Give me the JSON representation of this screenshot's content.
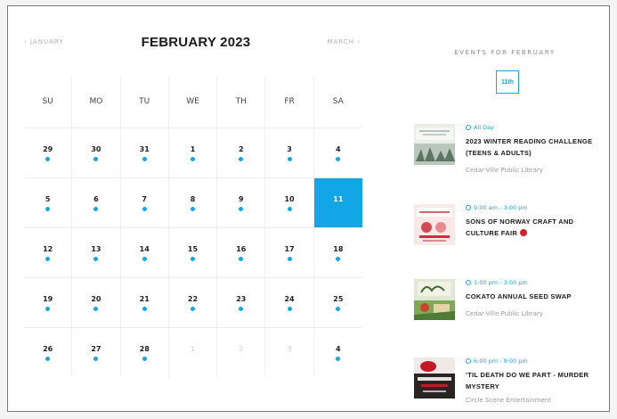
{
  "calendar": {
    "prev_label": "‹ JANUARY",
    "next_label": "MARCH ›",
    "month_title": "FEBRUARY 2023",
    "weekdays": [
      "SU",
      "MO",
      "TU",
      "WE",
      "TH",
      "FR",
      "SA"
    ],
    "weeks": [
      [
        {
          "d": "29",
          "dot": true,
          "muted": false
        },
        {
          "d": "30",
          "dot": true,
          "muted": false
        },
        {
          "d": "31",
          "dot": true,
          "muted": false
        },
        {
          "d": "1",
          "dot": true,
          "muted": false
        },
        {
          "d": "2",
          "dot": true,
          "muted": false
        },
        {
          "d": "3",
          "dot": true,
          "muted": false
        },
        {
          "d": "4",
          "dot": true,
          "muted": false
        }
      ],
      [
        {
          "d": "5",
          "dot": true,
          "muted": false
        },
        {
          "d": "6",
          "dot": true,
          "muted": false
        },
        {
          "d": "7",
          "dot": true,
          "muted": false
        },
        {
          "d": "8",
          "dot": true,
          "muted": false
        },
        {
          "d": "9",
          "dot": true,
          "muted": false
        },
        {
          "d": "10",
          "dot": true,
          "muted": false
        },
        {
          "d": "11",
          "dot": false,
          "muted": false,
          "selected": true
        }
      ],
      [
        {
          "d": "12",
          "dot": true,
          "muted": false
        },
        {
          "d": "13",
          "dot": true,
          "muted": false
        },
        {
          "d": "14",
          "dot": true,
          "muted": false
        },
        {
          "d": "15",
          "dot": true,
          "muted": false
        },
        {
          "d": "16",
          "dot": true,
          "muted": false
        },
        {
          "d": "17",
          "dot": true,
          "muted": false
        },
        {
          "d": "18",
          "dot": true,
          "muted": false
        }
      ],
      [
        {
          "d": "19",
          "dot": true,
          "muted": false
        },
        {
          "d": "20",
          "dot": true,
          "muted": false
        },
        {
          "d": "21",
          "dot": true,
          "muted": false
        },
        {
          "d": "22",
          "dot": true,
          "muted": false
        },
        {
          "d": "23",
          "dot": true,
          "muted": false
        },
        {
          "d": "24",
          "dot": true,
          "muted": false
        },
        {
          "d": "25",
          "dot": true,
          "muted": false
        }
      ],
      [
        {
          "d": "26",
          "dot": true,
          "muted": false
        },
        {
          "d": "27",
          "dot": true,
          "muted": false
        },
        {
          "d": "28",
          "dot": true,
          "muted": false
        },
        {
          "d": "1",
          "dot": false,
          "muted": true
        },
        {
          "d": "2",
          "dot": false,
          "muted": true
        },
        {
          "d": "3",
          "dot": false,
          "muted": true
        },
        {
          "d": "4",
          "dot": true,
          "muted": false
        }
      ]
    ]
  },
  "events_panel": {
    "title": "EVENTS FOR FEBRUARY",
    "day_tag": "11th",
    "events": [
      {
        "time": "All Day",
        "title": "2023 WINTER READING CHALLENGE (TEENS & ADULTS)",
        "venue": "Cedar-Ville Public Library",
        "red_dot": false
      },
      {
        "time": "9:00 am - 3:00 pm",
        "title": "SONS OF NORWAY CRAFT AND CULTURE FAIR",
        "venue": "",
        "red_dot": true
      },
      {
        "time": "1:00 pm - 3:00 pm",
        "title": "COKATO ANNUAL SEED SWAP",
        "venue": "Cedar-Ville Public Library",
        "red_dot": false
      },
      {
        "time": "6:00 pm - 9:00 pm",
        "title": "'TIL DEATH DO WE PART - MURDER MYSTERY",
        "venue": "Circle Scene Entertainment",
        "red_dot": false
      }
    ]
  },
  "colors": {
    "accent": "#13a6e6",
    "frame_border": "#7a7a7a",
    "red_badge": "#d81e2c"
  },
  "icons": [
    "clock-icon",
    "event-thumbnail"
  ]
}
